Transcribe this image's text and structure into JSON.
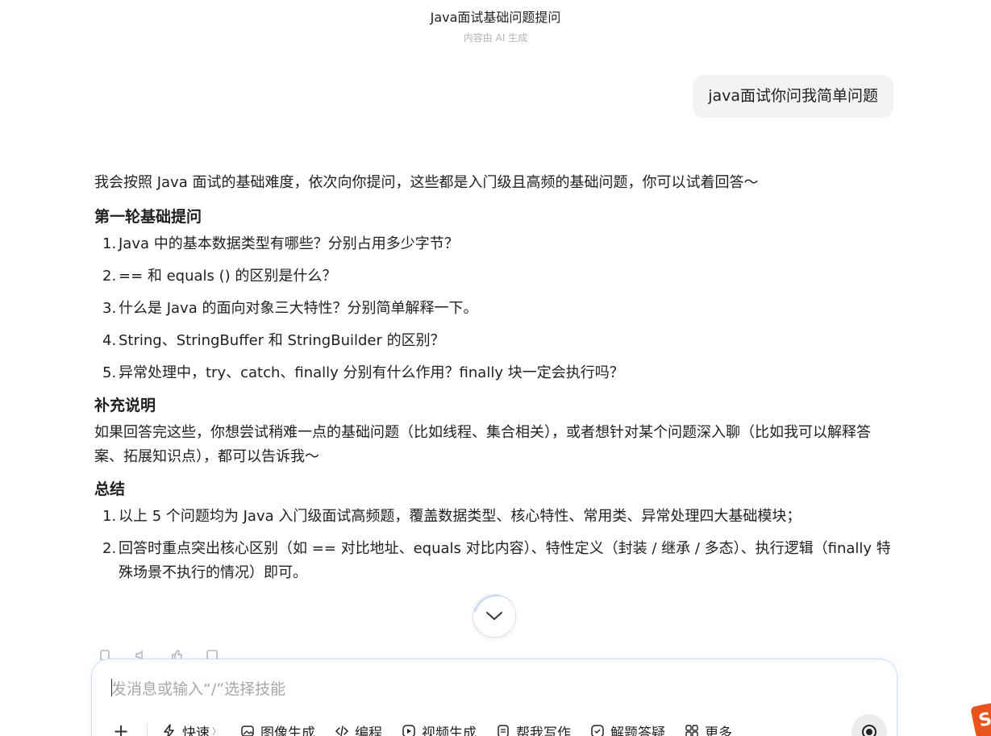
{
  "header": {
    "title": "Java面试基础问题提问",
    "subtitle": "内容由 AI 生成"
  },
  "user_message": "java面试你问我简单问题",
  "answer": {
    "lead": "我会按照 Java 面试的基础难度，依次向你提问，这些都是入门级且高频的基础问题，你可以试着回答～",
    "section1_title": "第一轮基础提问",
    "section1_items": [
      {
        "num": "1.",
        "text": "Java 中的基本数据类型有哪些？分别占用多少字节？"
      },
      {
        "num": "2.",
        "text": "== 和 equals () 的区别是什么？"
      },
      {
        "num": "3.",
        "text": "什么是 Java 的面向对象三大特性？分别简单解释一下。"
      },
      {
        "num": "4.",
        "text": "String、StringBuffer 和 StringBuilder 的区别？"
      },
      {
        "num": "5.",
        "text": "异常处理中，try、catch、finally 分别有什么作用？finally 块一定会执行吗？"
      }
    ],
    "section2_title": "补充说明",
    "section2_text": "如果回答完这些，你想尝试稍难一点的基础问题（比如线程、集合相关），或者想针对某个问题深入聊（比如我可以解释答案、拓展知识点），都可以告诉我～",
    "section3_title": "总结",
    "section3_items": [
      {
        "num": "1.",
        "text": "以上 5 个问题均为 Java 入门级面试高频题，覆盖数据类型、核心特性、常用类、异常处理四大基础模块；"
      },
      {
        "num": "2.",
        "text": "回答时重点突出核心区别（如 == 对比地址、equals 对比内容）、特性定义（封装 / 继承 / 多态）、执行逻辑（finally 特殊场景不执行的情况）即可。"
      }
    ]
  },
  "composer": {
    "placeholder": "发消息或输入“/”选择技能",
    "plus_label": "+",
    "tools": [
      {
        "label": "快速",
        "icon": "lightning-icon"
      },
      {
        "label": "图像生成",
        "icon": "image-icon"
      },
      {
        "label": "编程",
        "icon": "code-icon"
      },
      {
        "label": "视频生成",
        "icon": "video-icon"
      },
      {
        "label": "帮我写作",
        "icon": "write-icon"
      },
      {
        "label": "解题答疑",
        "icon": "answer-icon"
      },
      {
        "label": "更多",
        "icon": "grid-icon"
      }
    ]
  },
  "colors": {
    "accent_border": "#c9dcff",
    "bubble_bg": "#f3f3f3",
    "logo": "#e8541c"
  }
}
